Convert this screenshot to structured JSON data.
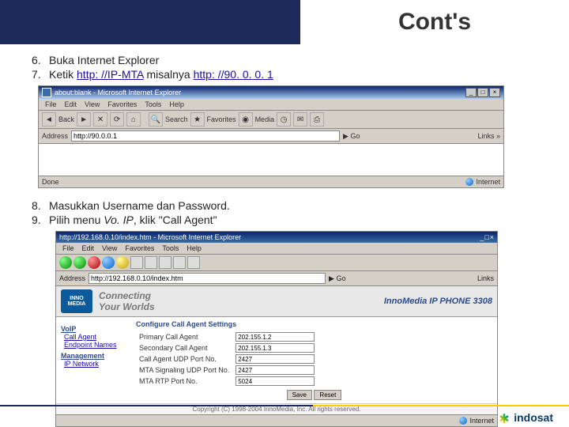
{
  "header": {
    "title": "Cont's"
  },
  "steps": {
    "s6": {
      "num": "6.",
      "text": "Buka Internet Explorer"
    },
    "s7": {
      "num": "7.",
      "prefix": "Ketik ",
      "link1": "http: //IP-MTA",
      "mid": " misalnya ",
      "link2": "http: //90. 0. 0. 1"
    },
    "s8": {
      "num": "8.",
      "text": "Masukkan Username dan Password."
    },
    "s9": {
      "num": "9.",
      "prefix": "Pilih menu ",
      "em": "Vo. IP",
      "suffix": ", klik \"Call Agent\""
    }
  },
  "ie1": {
    "title": "about:blank - Microsoft Internet Explorer",
    "menu": [
      "File",
      "Edit",
      "View",
      "Favorites",
      "Tools",
      "Help"
    ],
    "toolbar": {
      "back": "Back",
      "forward": "",
      "stop": "",
      "refresh": "",
      "home": "",
      "search": "Search",
      "fav": "Favorites",
      "media": "Media"
    },
    "addr_label": "Address",
    "addr_value": "http://90.0.0.1",
    "go": "Go",
    "links": "Links »",
    "status": "Done",
    "zone": "Internet"
  },
  "ie2": {
    "title": "http://192.168.0.10/index.htm - Microsoft Internet Explorer",
    "menu": [
      "File",
      "Edit",
      "View",
      "Favorites",
      "Tools",
      "Help"
    ],
    "addr_label": "Address",
    "addr_value": "http://192.168.0.10/index.htm",
    "go": "Go",
    "links": "Links",
    "banner": {
      "logo1": "INNO",
      "logo2": "MEDIA",
      "tag1": "Connecting",
      "tag2": "Your Worlds",
      "product": "InnoMedia IP PHONE 3308"
    },
    "sidebar": {
      "h1": "VoIP",
      "l1": "Call Agent",
      "l2": "Endpoint Names",
      "h2": "Management",
      "l3": "IP Network"
    },
    "config": {
      "title": "Configure Call Agent Settings",
      "rows": [
        {
          "label": "Primary Call Agent",
          "value": "202.155.1.2"
        },
        {
          "label": "Secondary Call Agent",
          "value": "202.155.1.3"
        },
        {
          "label": "Call Agent UDP Port No.",
          "value": "2427"
        },
        {
          "label": "MTA Signaling UDP Port No.",
          "value": "2427"
        },
        {
          "label": "MTA RTP Port No.",
          "value": "5024"
        }
      ],
      "save": "Save",
      "reset": "Reset"
    },
    "copyright": "Copyright (C) 1998-2004 InnoMedia, Inc. All rights reserved.",
    "zone": "Internet"
  },
  "footer": {
    "brand": "indosat"
  }
}
